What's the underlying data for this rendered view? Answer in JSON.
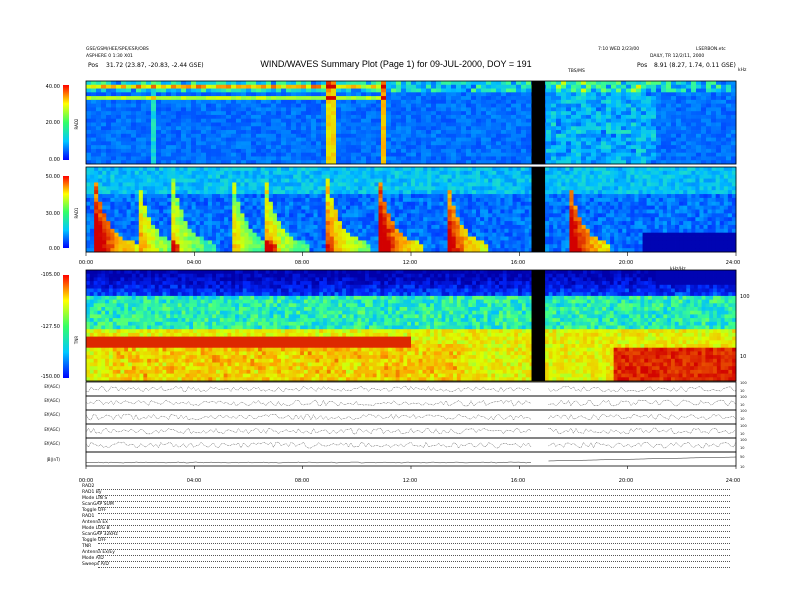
{
  "header": {
    "title": "WIND/WAVES Summary Plot (Page 1) for 09-JUL-2000, DOY = 191",
    "left_line1": "GSE/GSM/HEE/SPE/ESR/OBS",
    "left_line2": "ASPHERE 0 1:30 X01",
    "left_pos_label": "Pos",
    "left_pos_value": "31.72 (23.87, -20.83, -2.44 GSE)",
    "right_line1": "7:10 WED 2/23/00",
    "right_line2": "LSERBON.etc",
    "right_line3": "DAILY, TR 12/2/11, 2000",
    "right_pos_label": "Pos",
    "right_pos_value": "8.91 (8.27, 1.74, 0.11 GSE)",
    "right_unit": "kHz",
    "marker_label": "TBS/MS"
  },
  "chart_data": [
    {
      "type": "heatmap",
      "panel": "RAD2",
      "ylabel": "RAD2",
      "ytick_labels": [
        "40.00",
        "20.00",
        "0.00"
      ],
      "yticks": [
        40,
        20,
        0
      ],
      "ylim": [
        0,
        40
      ],
      "gap_hours": [
        16.45,
        16.95
      ],
      "bursts": [
        {
          "t": 2.5,
          "f": 0.3
        },
        {
          "t": 9.0,
          "f": 0.9
        },
        {
          "t": 11.0,
          "f": 1.0
        }
      ]
    },
    {
      "type": "heatmap",
      "panel": "RAD1",
      "ylabel": "RAD1",
      "ytick_labels": [
        "50.00",
        "30.00",
        "0.00"
      ],
      "yticks": [
        50,
        30,
        0
      ],
      "ylim": [
        0,
        50
      ],
      "gap_hours": [
        16.45,
        16.95
      ],
      "bursts": [
        {
          "t": 0.3,
          "i": 1.0
        },
        {
          "t": 1.9,
          "i": 0.6
        },
        {
          "t": 3.2,
          "i": 0.5
        },
        {
          "t": 5.4,
          "i": 0.5
        },
        {
          "t": 6.6,
          "i": 0.6
        },
        {
          "t": 8.9,
          "i": 0.7
        },
        {
          "t": 10.8,
          "i": 1.0
        },
        {
          "t": 13.3,
          "i": 0.9
        },
        {
          "t": 17.8,
          "i": 1.0
        }
      ]
    },
    {
      "type": "heatmap",
      "panel": "TNR",
      "ylabel": "TNR",
      "ytick_labels": [
        "-105.00",
        "-127.50",
        "-150.00"
      ],
      "yticks": [
        -105,
        -127.5,
        -150
      ],
      "ylim": [
        -150,
        -105
      ],
      "right_tick_labels": [
        "100",
        "10"
      ],
      "gap_hours": [
        16.45,
        16.95
      ]
    },
    {
      "type": "line",
      "panels": [
        {
          "label": "Ef(AGC)",
          "right_ticks": [
            "100",
            "10"
          ]
        },
        {
          "label": "Ef(AGC)",
          "right_ticks": [
            "100",
            "10"
          ]
        },
        {
          "label": "Ef(AGC)",
          "right_ticks": [
            "100",
            "10"
          ]
        },
        {
          "label": "Ef(AGC)",
          "right_ticks": [
            "100",
            "10"
          ]
        },
        {
          "label": "Ef(AGC)",
          "right_ticks": [
            "100",
            "10"
          ]
        },
        {
          "label": "|B|(nT)",
          "right_ticks": [
            "50",
            "10"
          ]
        }
      ],
      "x_tick_labels": [
        "00:00",
        "04:00",
        "08:00",
        "12:00",
        "16:00",
        "20:00",
        "24:00"
      ],
      "xlim": [
        0,
        24
      ]
    }
  ],
  "axis_mid": {
    "x_tick_labels": [
      "00:00",
      "04:00",
      "08:00",
      "12:00",
      "16:00",
      "20:00",
      "24:00"
    ],
    "right_label": "kHz/Hz"
  },
  "footer": {
    "rows": [
      {
        "k": "RAD2",
        "v": ""
      },
      {
        "k": "RAD1",
        "v": "By"
      },
      {
        "k": "Mode",
        "v": "LIN S"
      },
      {
        "k": "ScanGAP",
        "v": "SUM"
      },
      {
        "k": "Toggle",
        "v": "OFF"
      },
      {
        "k": "RAD1",
        "v": ""
      },
      {
        "k": "Antenna",
        "v": "Ex"
      },
      {
        "k": "Mode",
        "v": "LOG B"
      },
      {
        "k": "ScanGAP",
        "v": "32kHz"
      },
      {
        "k": "Toggle",
        "v": "OFF"
      },
      {
        "k": "TNR",
        "v": ""
      },
      {
        "k": "Antenna",
        "v": "Ex/Ey"
      },
      {
        "k": "Mode",
        "v": "A/D"
      },
      {
        "k": "Sweeps",
        "v": "A/D"
      }
    ]
  }
}
